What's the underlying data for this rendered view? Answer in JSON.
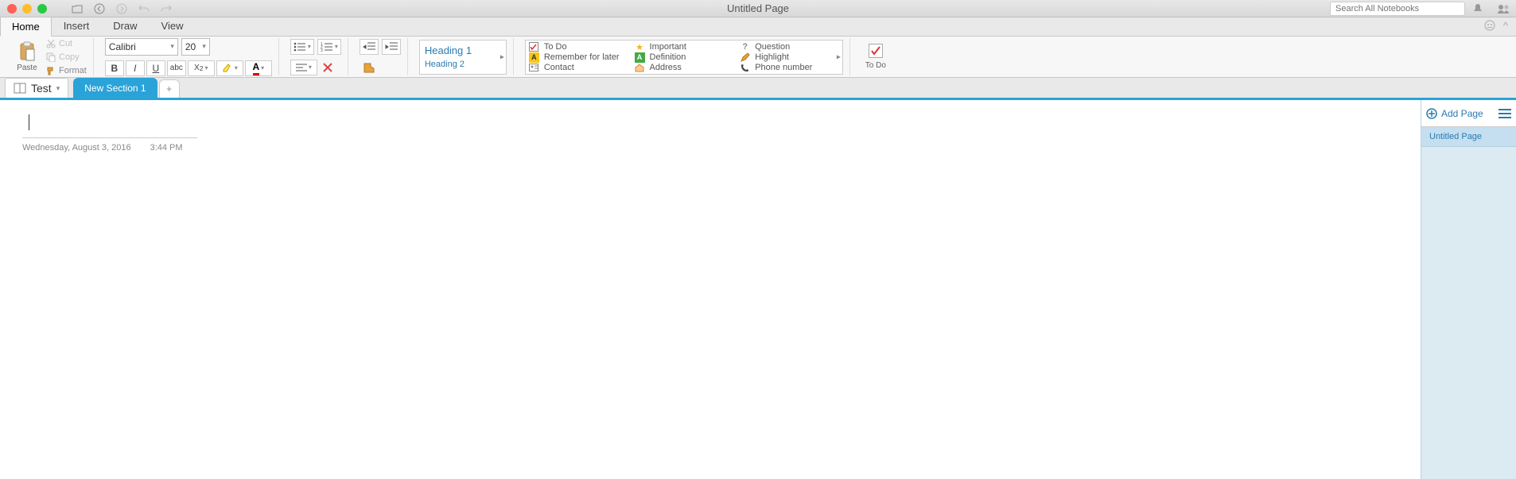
{
  "window": {
    "title": "Untitled Page"
  },
  "search": {
    "placeholder": "Search All Notebooks"
  },
  "tabs": {
    "home": "Home",
    "insert": "Insert",
    "draw": "Draw",
    "view": "View"
  },
  "ribbon": {
    "paste": "Paste",
    "cut": "Cut",
    "copy": "Copy",
    "format": "Format",
    "font_name": "Calibri",
    "font_size": "20",
    "heading1": "Heading 1",
    "heading2": "Heading 2",
    "todo": "To Do",
    "tags": {
      "todo": "To Do",
      "important": "Important",
      "question": "Question",
      "remember": "Remember for later",
      "definition": "Definition",
      "highlight": "Highlight",
      "contact": "Contact",
      "address": "Address",
      "phone": "Phone number"
    }
  },
  "notebook": {
    "name": "Test"
  },
  "section": {
    "name": "New Section 1"
  },
  "page": {
    "date": "Wednesday, August 3, 2016",
    "time": "3:44 PM"
  },
  "side": {
    "add_page": "Add Page",
    "current_page": "Untitled Page"
  }
}
